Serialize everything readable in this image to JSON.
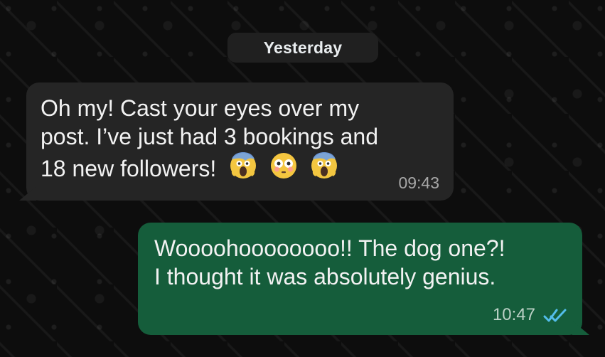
{
  "chat": {
    "date_chip": "Yesterday",
    "messages": [
      {
        "direction": "incoming",
        "lines": [
          "Oh my! Cast your eyes over my",
          "post. I’ve just had 3 bookings and",
          "18 new followers!"
        ],
        "emojis": [
          "face-screaming-in-fear",
          "flushed-face",
          "face-screaming-in-fear"
        ],
        "time": "09:43"
      },
      {
        "direction": "outgoing",
        "lines": [
          "Woooohoooooooo!! The dog one?!",
          "I thought it was absolutely genius."
        ],
        "time": "10:47",
        "status": "read",
        "status_icon": "double-check-icon",
        "status_color": "#53bdeb"
      }
    ]
  }
}
